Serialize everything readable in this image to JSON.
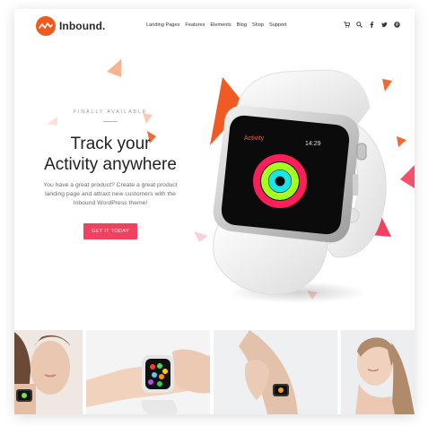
{
  "brand": {
    "name": "Inbound.",
    "logo_color": "#ef5b1e"
  },
  "nav": {
    "items": [
      "Landing Pages",
      "Features",
      "Elements",
      "Blog",
      "Shop",
      "Support"
    ],
    "icons": [
      "cart-icon",
      "search-icon",
      "facebook-icon",
      "twitter-icon",
      "pinterest-icon"
    ]
  },
  "hero": {
    "eyebrow": "FINALLY AVAILABLE",
    "title_line1": "Track your",
    "title_line2": "Activity anywhere",
    "subtitle": "You have a great product? Create a great product landing page and attract new customers with the Inbound WordPress theme!",
    "cta_label": "GET IT TODAY",
    "accent_color": "#f0415f"
  },
  "watch": {
    "app_label": "Activity",
    "time": "14:29"
  },
  "gallery": {
    "photo_count": 4
  }
}
